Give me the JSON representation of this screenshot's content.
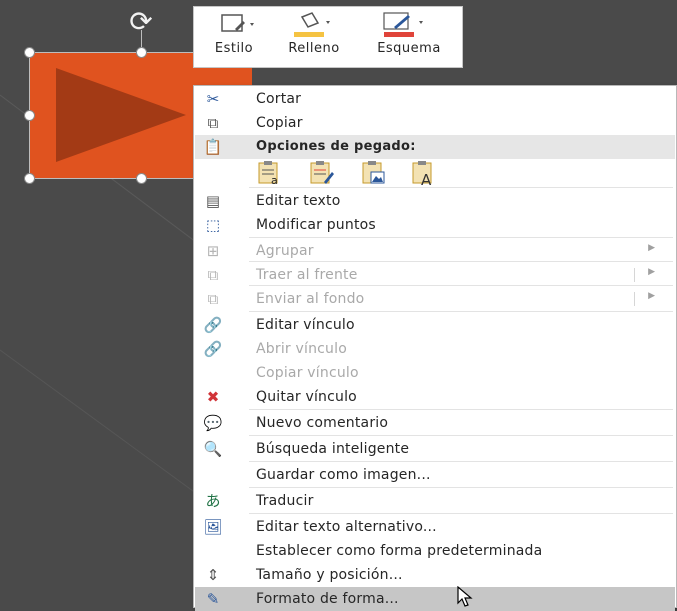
{
  "mini_toolbar": {
    "style_label": "Estilo",
    "fill_label": "Relleno",
    "outline_label": "Esquema",
    "fill_color": "#f5c342",
    "outline_color": "#e0443a"
  },
  "menu": {
    "items": [
      {
        "label": "Cortar",
        "icon": "scissors-icon"
      },
      {
        "label": "Copiar",
        "icon": "copy-icon"
      },
      {
        "label": "Opciones de pegado:",
        "icon": "paste-icon"
      },
      {
        "label": "Editar texto",
        "icon": "edit-text-icon"
      },
      {
        "label": "Modificar puntos",
        "icon": "edit-points-icon"
      },
      {
        "label": "Agrupar",
        "icon": "group-icon"
      },
      {
        "label": "Traer al frente",
        "icon": "bring-front-icon"
      },
      {
        "label": "Enviar al fondo",
        "icon": "send-back-icon"
      },
      {
        "label": "Editar vínculo",
        "icon": "link-icon"
      },
      {
        "label": "Abrir vínculo",
        "icon": "open-link-icon"
      },
      {
        "label": "Copiar vínculo",
        "icon": ""
      },
      {
        "label": "Quitar vínculo",
        "icon": "remove-link-icon"
      },
      {
        "label": "Nuevo comentario",
        "icon": "comment-icon"
      },
      {
        "label": "Búsqueda inteligente",
        "icon": "smart-lookup-icon"
      },
      {
        "label": "Guardar como imagen...",
        "icon": ""
      },
      {
        "label": "Traducir",
        "icon": "translate-icon"
      },
      {
        "label": "Editar texto alternativo...",
        "icon": "alt-text-icon"
      },
      {
        "label": "Establecer como forma predeterminada",
        "icon": ""
      },
      {
        "label": "Tamaño y posición...",
        "icon": "size-position-icon"
      },
      {
        "label": "Formato de forma...",
        "icon": "format-shape-icon"
      }
    ],
    "paste_options": [
      "paste-keep-source-icon",
      "paste-destination-theme-icon",
      "paste-picture-icon",
      "paste-text-only-icon"
    ]
  }
}
